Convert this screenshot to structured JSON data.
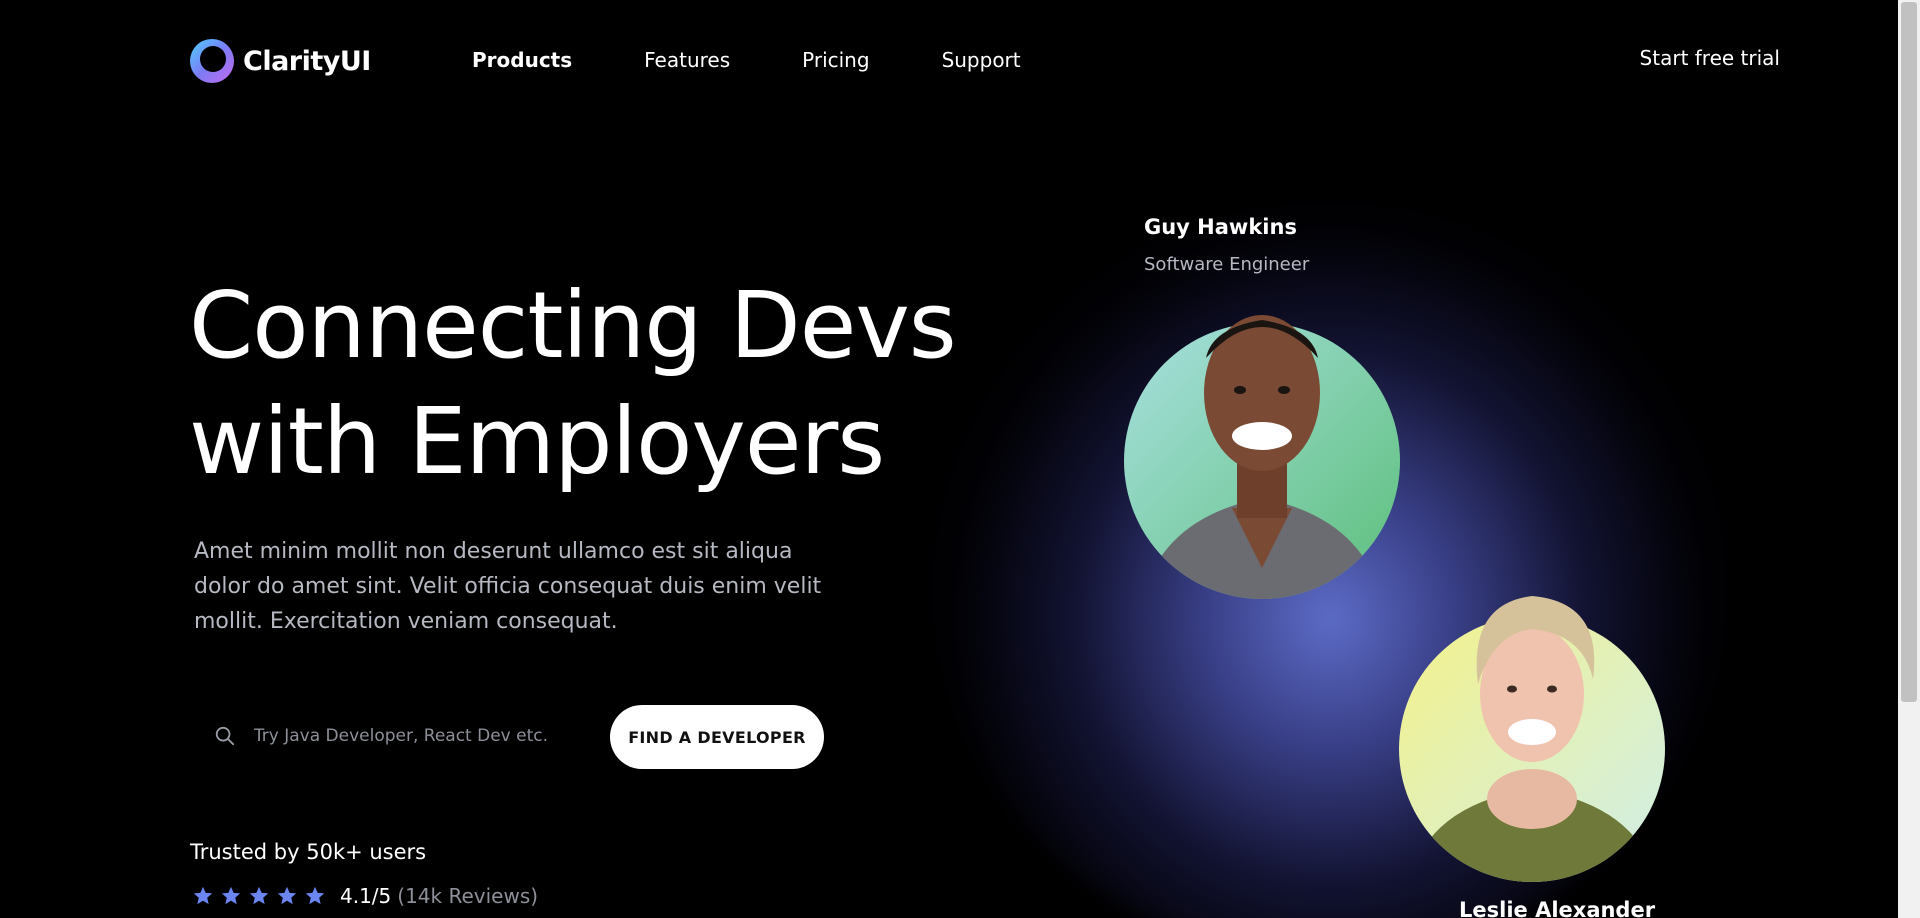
{
  "nav": {
    "brand": "ClarityUI",
    "links": [
      "Products",
      "Features",
      "Pricing",
      "Support"
    ],
    "cta": "Start free trial"
  },
  "hero": {
    "title_line1": "Connecting Devs",
    "title_line2": "with Employers",
    "description": "Amet minim mollit non deserunt ullamco est sit aliqua dolor do amet sint. Velit officia consequat duis enim velit mollit. Exercitation veniam consequat.",
    "search_placeholder": "Try Java Developer, React Dev etc.",
    "button_label": "FIND A DEVELOPER",
    "trusted": "Trusted by 50k+ users",
    "rating_value": "4.1/5",
    "rating_reviews": "(14k Reviews)",
    "stars": 5
  },
  "people": [
    {
      "name": "Guy Hawkins",
      "role": "Software Engineer"
    },
    {
      "name": "Leslie Alexander",
      "role": ""
    }
  ],
  "colors": {
    "background": "#000000",
    "accent_glow": "#5f70d0",
    "star": "#6b86f0",
    "muted_text": "#b6b8c2"
  },
  "icons": {
    "logo": "clarityui-logo",
    "search": "search-icon",
    "star": "star-icon"
  }
}
